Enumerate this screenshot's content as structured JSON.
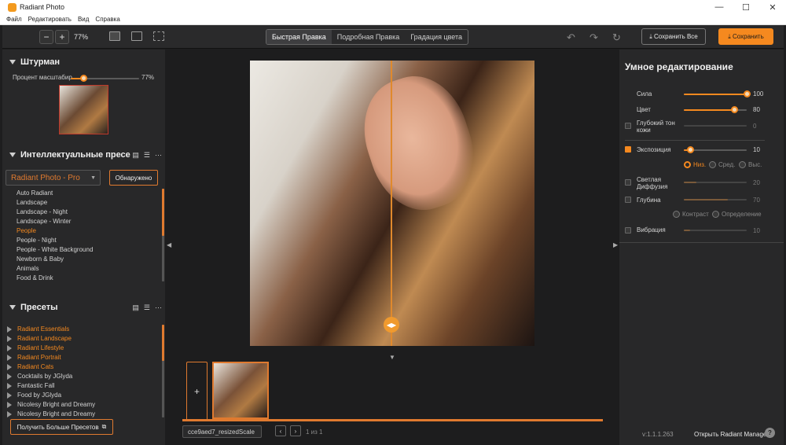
{
  "window": {
    "title": "Radiant Photo",
    "controls": [
      "—",
      "☐",
      "✕"
    ]
  },
  "menu": [
    "Файл",
    "Редактировать",
    "Вид",
    "Справка"
  ],
  "toolbar": {
    "zoom_out": "−",
    "zoom_in": "+",
    "zoom_value": "77%",
    "tabs": [
      {
        "label": "Быстрая Правка",
        "active": true
      },
      {
        "label": "Подробная Правка",
        "active": false
      },
      {
        "label": "Градация цвета",
        "active": false
      }
    ],
    "save_all_label": "⤓ Сохранить Все",
    "save_label": "⤓ Сохранить"
  },
  "navigator": {
    "title": "Штурман",
    "zoom_label": "Процент масштабир",
    "zoom_value": "77%"
  },
  "intelligent_presets": {
    "title": "Интеллектуальные пресе",
    "selected_pack": "Radiant Photo - Pro",
    "detect_label": "Обнаружено",
    "items": [
      {
        "label": "Auto Radiant",
        "selected": false
      },
      {
        "label": "Landscape",
        "selected": false
      },
      {
        "label": "Landscape - Night",
        "selected": false
      },
      {
        "label": "Landscape - Winter",
        "selected": false
      },
      {
        "label": "People",
        "selected": true
      },
      {
        "label": "People - Night",
        "selected": false
      },
      {
        "label": "People - White Background",
        "selected": false
      },
      {
        "label": "Newborn & Baby",
        "selected": false
      },
      {
        "label": "Animals",
        "selected": false
      },
      {
        "label": "Food & Drink",
        "selected": false
      }
    ]
  },
  "presets": {
    "title": "Пресеты",
    "items": [
      {
        "label": "Radiant Essentials",
        "accent": true
      },
      {
        "label": "Radiant Landscape",
        "accent": true
      },
      {
        "label": "Radiant Lifestyle",
        "accent": true
      },
      {
        "label": "Radiant Portrait",
        "accent": true
      },
      {
        "label": "Radiant Cats",
        "accent": true
      },
      {
        "label": "Cocktails by JGlyda",
        "accent": false
      },
      {
        "label": "Fantastic Fall",
        "accent": false
      },
      {
        "label": "Food by JGlyda",
        "accent": false
      },
      {
        "label": "Nicolesy Bright and Dreamy",
        "accent": false
      },
      {
        "label": "Nicolesy Bright and Dreamy",
        "accent": false
      }
    ],
    "more_label": "Получить Больше Пресетов"
  },
  "filmstrip": {
    "add_label": "+",
    "filename": "cce9aed7_resizedScale",
    "prev": "‹",
    "next": "›",
    "page_text": "1 из 1"
  },
  "smart_edit": {
    "title": "Умное редактирование",
    "sliders": [
      {
        "label": "Сила",
        "value": "100",
        "level": 1.0,
        "has_checkbox": false,
        "checked": false,
        "enabled": true
      },
      {
        "label": "Цвет",
        "value": "80",
        "level": 0.8,
        "has_checkbox": false,
        "checked": false,
        "enabled": true
      },
      {
        "label": "Глубокий тон кожи",
        "value": "0",
        "level": 0.0,
        "has_checkbox": true,
        "checked": false,
        "enabled": false
      },
      {
        "label": "Экспозиция",
        "value": "10",
        "level": 0.1,
        "has_checkbox": true,
        "checked": true,
        "enabled": true
      },
      {
        "label": "Светлая Диффузия",
        "value": "20",
        "level": 0.2,
        "has_checkbox": true,
        "checked": false,
        "enabled": false
      },
      {
        "label": "Глубина",
        "value": "70",
        "level": 0.7,
        "has_checkbox": true,
        "checked": false,
        "enabled": false
      },
      {
        "label": "Вибрация",
        "value": "10",
        "level": 0.1,
        "has_checkbox": true,
        "checked": false,
        "enabled": false
      }
    ],
    "exposure_modes": [
      {
        "label": "Низ.",
        "selected": true
      },
      {
        "label": "Сред.",
        "selected": false
      },
      {
        "label": "Выс.",
        "selected": false
      }
    ],
    "depth_modes": [
      {
        "label": "Контраст",
        "selected": false
      },
      {
        "label": "Определение",
        "selected": false
      }
    ]
  },
  "footer": {
    "version": "v:1.1.1.263",
    "manager_label": "Открыть Radiant Manager",
    "help": "?"
  },
  "colors": {
    "accent": "#f5891f",
    "panel": "#282829",
    "canvas": "#1d1d1e"
  }
}
